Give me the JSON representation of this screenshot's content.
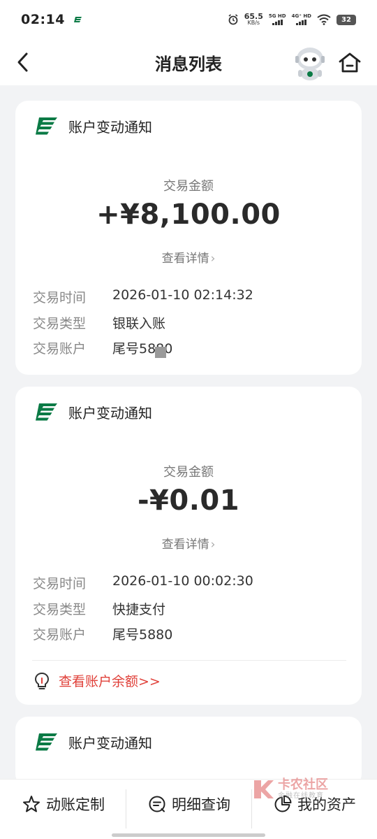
{
  "status_bar": {
    "time": "02:14",
    "net_speed_value": "65.5",
    "net_speed_unit": "KB/s",
    "signal_1": "5G HD",
    "signal_2": "4G⁺ HD",
    "battery": "32"
  },
  "header": {
    "title": "消息列表"
  },
  "messages": [
    {
      "title": "账户变动通知",
      "amount_label": "交易金额",
      "amount": "+¥8,100.00",
      "detail_link": "查看详情",
      "rows": [
        {
          "key": "交易时间",
          "value": "2026-01-10 02:14:32"
        },
        {
          "key": "交易类型",
          "value": "银联入账"
        },
        {
          "key": "交易账户",
          "value": "尾号5880"
        }
      ]
    },
    {
      "title": "账户变动通知",
      "amount_label": "交易金额",
      "amount": "-¥0.01",
      "detail_link": "查看详情",
      "rows": [
        {
          "key": "交易时间",
          "value": "2026-01-10 00:02:30"
        },
        {
          "key": "交易类型",
          "value": "快捷支付"
        },
        {
          "key": "交易账户",
          "value": "尾号5880"
        }
      ],
      "balance_link": "查看账户余额>>"
    },
    {
      "title": "账户变动通知"
    }
  ],
  "bottom_tabs": [
    {
      "label": "动账定制",
      "icon": "star-outline-icon"
    },
    {
      "label": "明细查询",
      "icon": "search-list-icon"
    },
    {
      "label": "我的资产",
      "icon": "pie-chart-icon"
    }
  ],
  "watermark": {
    "title": "卡农社区",
    "subtitle": "金融在线教育"
  },
  "colors": {
    "brand_green": "#0a7a45",
    "link_red": "#e0413a"
  }
}
